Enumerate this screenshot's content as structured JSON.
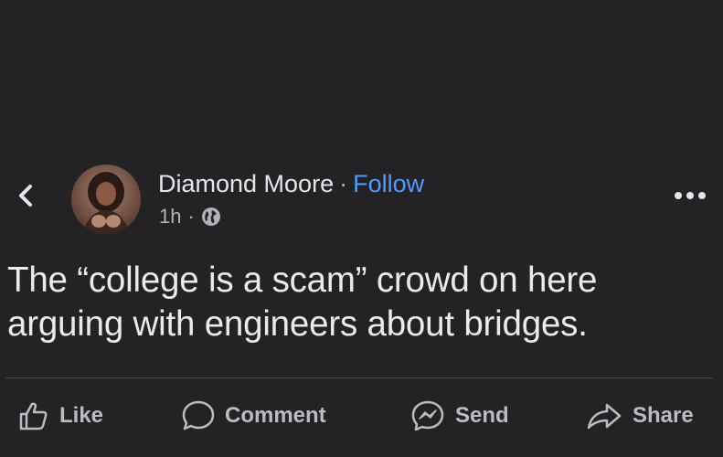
{
  "post": {
    "author": "Diamond Moore",
    "separator": "·",
    "follow_label": "Follow",
    "time": "1h",
    "meta_separator": "·",
    "privacy_icon": "globe-icon",
    "body": "The “college is a scam” crowd on here arguing with engineers about bridges."
  },
  "actions": {
    "like": {
      "label": "Like",
      "icon": "thumbs-up-icon"
    },
    "comment": {
      "label": "Comment",
      "icon": "comment-bubble-icon"
    },
    "send": {
      "label": "Send",
      "icon": "messenger-icon"
    },
    "share": {
      "label": "Share",
      "icon": "share-arrow-icon"
    }
  },
  "icons": {
    "back": "chevron-left-icon",
    "more": "more-horizontal-icon"
  },
  "colors": {
    "background": "#232325",
    "text": "#e4e6eb",
    "secondary_text": "#b0b3b8",
    "accent": "#4f9bff"
  }
}
